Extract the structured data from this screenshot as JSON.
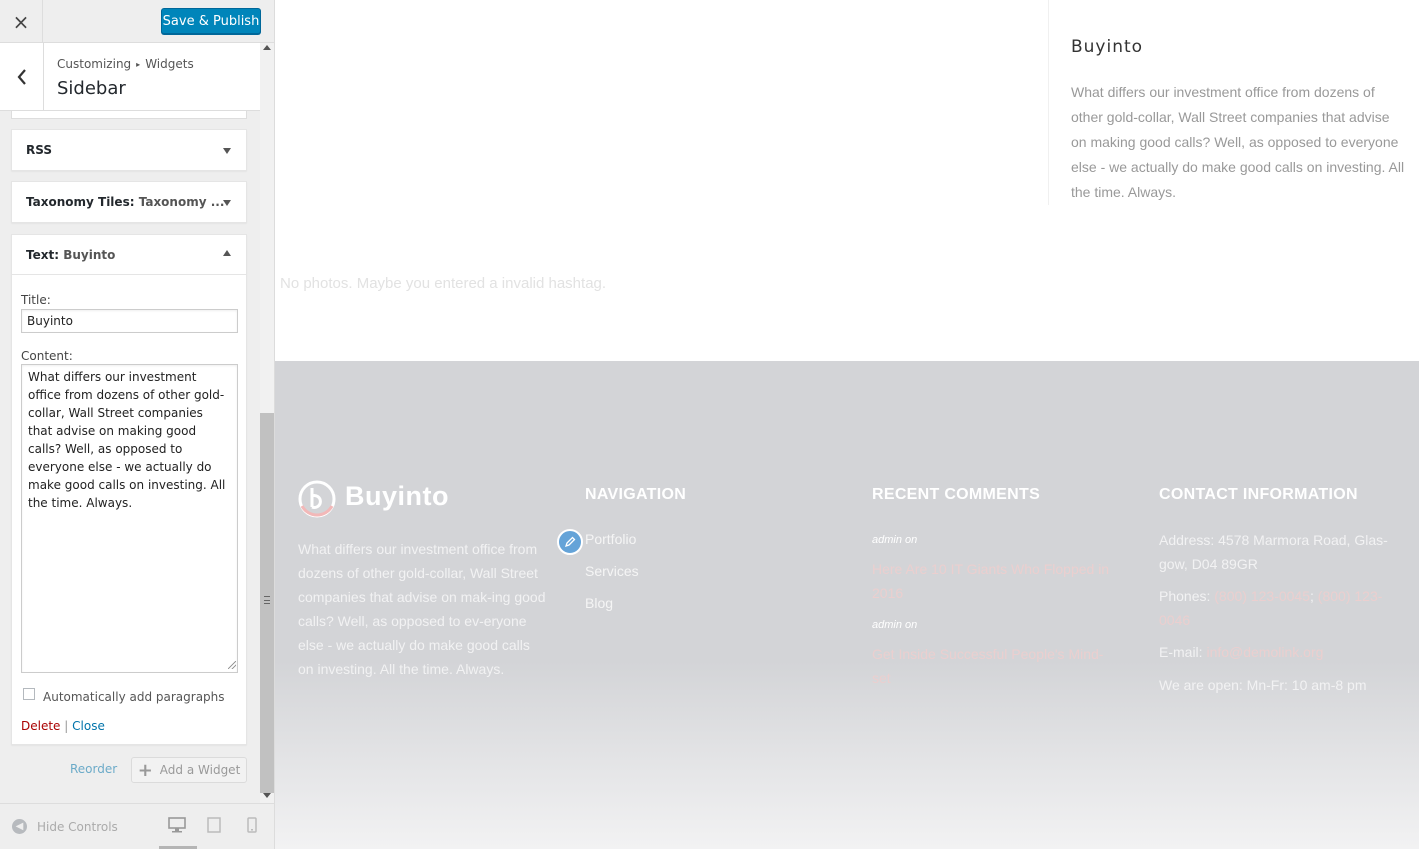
{
  "customizer": {
    "close_label": "×",
    "publish_label": "Save & Publish",
    "breadcrumb": [
      "Customizing",
      "Widgets"
    ],
    "breadcrumb_sep": "▸",
    "section_title": "Sidebar",
    "widgets": [
      {
        "type": "RSS",
        "instance": "",
        "expanded": false
      },
      {
        "type": "Taxonomy Tiles:",
        "instance": "Taxonomy ...",
        "expanded": false
      },
      {
        "type": "Text:",
        "instance": "Buyinto",
        "expanded": true
      }
    ],
    "text_widget": {
      "title_label": "Title:",
      "title_value": "Buyinto",
      "content_label": "Content:",
      "content_value": "What differs our investment office from dozens of other gold-collar, Wall Street companies that advise on making good calls? Well, as opposed to everyone else - we actually do make good calls on investing. All the time. Always.",
      "autop_label": "Automatically add paragraphs",
      "autop_checked": false,
      "delete_label": "Delete",
      "link_sep": "|",
      "close_label": "Close"
    },
    "reorder_label": "Reorder",
    "add_widget_label": "Add a Widget",
    "hide_controls_label": "Hide Controls",
    "devices": [
      "desktop-icon",
      "tablet-icon",
      "mobile-icon"
    ],
    "active_device": "desktop"
  },
  "preview": {
    "sidebar_widget": {
      "title": "Buyinto",
      "text": "What differs our investment office from dozens of other gold-collar, Wall Street companies that advise on making good calls? Well, as opposed to everyone else - we actually do make good calls on investing. All the time. Always."
    },
    "instagram_message": "No photos. Maybe you entered a invalid hashtag.",
    "footer": {
      "logo_text": "Buyinto",
      "about": "What differs our investment office from dozens of other gold-collar, Wall Street companies that advise on mak-ing good calls? Well, as opposed to ev-eryone else - we actually do make good calls on investing. All the time. Always.",
      "navigation": {
        "heading": "NAVIGATION",
        "links": [
          "Portfolio",
          "Services",
          "Blog"
        ]
      },
      "recent_comments": {
        "heading": "RECENT COMMENTS",
        "items": [
          {
            "meta": "admin  on",
            "title": "Here Are 10 IT Giants Who Flopped in 2016"
          },
          {
            "meta": "admin  on",
            "title": "Get Inside Successful People's Mind-set"
          }
        ]
      },
      "contact": {
        "heading": "CONTACT INFORMATION",
        "address": "Address: 4578 Marmora Road, Glas-gow, D04 89GR",
        "phones_label": "Phones:",
        "phone_1": "(800) 123-0045",
        "phone_sep": ";",
        "phone_2": "(800) 123-0046",
        "email_label": "E-mail:",
        "email": "info@demolink.org",
        "hours": "We are open: Mn-Fr: 10 am-8 pm"
      }
    }
  },
  "colors": {
    "publish_blue": "#0085ba",
    "link_blue": "#0073aa",
    "delete_red": "#aa0000",
    "footer_bg": "#d3d4d7",
    "logo_accent": "#f2b8b8"
  }
}
